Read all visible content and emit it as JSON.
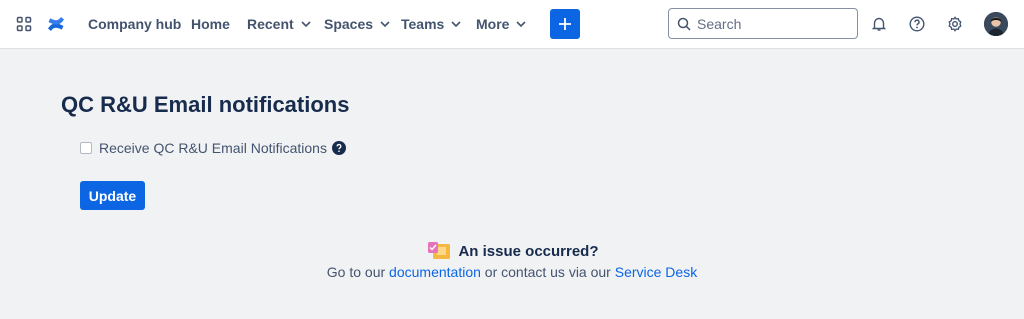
{
  "topbar": {
    "app_switcher_icon": "grid-icon",
    "logo_icon": "confluence-logo-icon",
    "nav": [
      {
        "label": "Company hub",
        "has_menu": false
      },
      {
        "label": "Home",
        "has_menu": false
      },
      {
        "label": "Recent",
        "has_menu": true
      },
      {
        "label": "Spaces",
        "has_menu": true
      },
      {
        "label": "Teams",
        "has_menu": true
      },
      {
        "label": "More",
        "has_menu": true
      }
    ],
    "create_icon": "plus-icon",
    "search": {
      "placeholder": "Search",
      "value": ""
    },
    "notifications_icon": "bell-icon",
    "help_icon": "question-circle-icon",
    "settings_icon": "gear-icon",
    "accent": "#0c66e4"
  },
  "main": {
    "title": "QC R&U Email notifications",
    "checkbox": {
      "label": "Receive QC R&U Email Notifications",
      "checked": false
    },
    "update_label": "Update"
  },
  "issue": {
    "title": "An issue occurred?",
    "prefix": "Go to our ",
    "doc_link": "documentation",
    "middle": " or contact us via our ",
    "service_link": "Service Desk"
  }
}
